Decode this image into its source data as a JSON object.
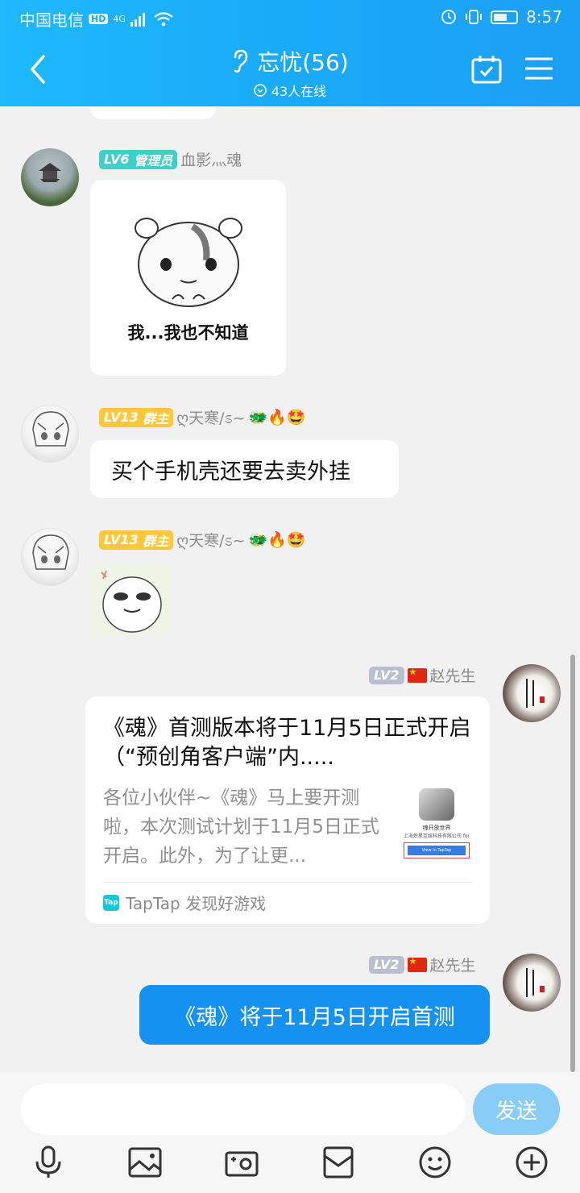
{
  "status_bar": {
    "carrier": "中国电信",
    "hd": "HD",
    "network": "4G",
    "time": "8:57"
  },
  "header": {
    "title": "忘忧(56)",
    "online": "43人在线"
  },
  "messages": [
    {
      "level": "LV6",
      "role": "管理员",
      "name": "血影灬魂",
      "sticker_caption": "我...我也不知道"
    },
    {
      "level": "LV13",
      "role": "群主",
      "name": "ღ天寒/ಽ~",
      "emoji": "🐲🔥🤩",
      "text": "买个手机壳还要去卖外挂"
    },
    {
      "level": "LV13",
      "role": "群主",
      "name": "ღ天寒/ಽ~",
      "emoji": "🐲🔥🤩"
    },
    {
      "level": "LV2",
      "name": "赵先生",
      "card": {
        "title": "《魂》首测版本将于11月5日正式开启（“预创角客户端”内.....",
        "desc": "各位小伙伴~《魂》马上要开测啦，本次测试计划于11月5日正式开启。此外，为了让更...",
        "thumb_title": "魂开放世界",
        "thumb_company": "上海炽星互娱科技有限公司 for",
        "thumb_button": "View in TapTap",
        "source": "TapTap 发现好游戏",
        "source_logo": "Tap"
      }
    },
    {
      "level": "LV2",
      "name": "赵先生",
      "text": "《魂》将于11月5日开启首测"
    }
  ],
  "input": {
    "placeholder": "",
    "send_label": "发送"
  },
  "colors": {
    "header": "#19aaf8",
    "self_bubble": "#1591f2",
    "send_button": "#88cdf8"
  }
}
